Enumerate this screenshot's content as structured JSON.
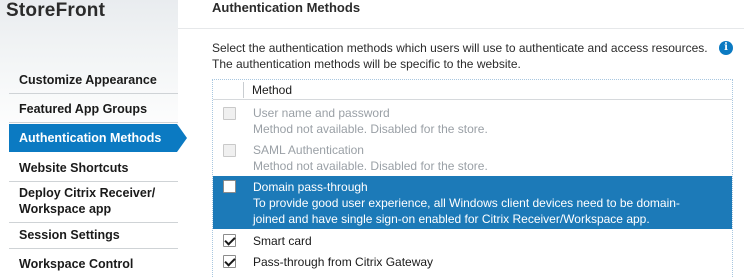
{
  "app": {
    "title": "StoreFront"
  },
  "sidebar": {
    "items": [
      {
        "label": "Customize Appearance"
      },
      {
        "label": "Featured App Groups"
      },
      {
        "label": "Authentication Methods",
        "active": true
      },
      {
        "label": "Website Shortcuts"
      },
      {
        "label_line1": "Deploy Citrix Receiver/",
        "label_line2": "Workspace app"
      },
      {
        "label": "Session Settings"
      },
      {
        "label": "Workspace Control"
      }
    ]
  },
  "panel": {
    "title": "Authentication Methods",
    "description_line1": "Select the authentication methods which users will use to authenticate and access resources.",
    "description_line2": "The authentication methods will be specific to the website.",
    "info_icon": "i"
  },
  "table": {
    "header": "Method",
    "rows": [
      {
        "title": "User name and password",
        "subtitle": "Method not available. Disabled for the store.",
        "checked": false,
        "disabled": true
      },
      {
        "title": "SAML Authentication",
        "subtitle": "Method not available. Disabled for the store.",
        "checked": false,
        "disabled": true
      },
      {
        "title": "Domain pass-through",
        "subtitle_line1": "To provide good user experience, all Windows client devices need to be domain-",
        "subtitle_line2": "joined and have single sign-on enabled for Citrix Receiver/Workspace app.",
        "checked": false,
        "selected": true
      },
      {
        "title": "Smart card",
        "checked": true
      },
      {
        "title": "Pass-through from Citrix Gateway",
        "checked": true
      }
    ]
  },
  "colors": {
    "accent": "#0b7ac2",
    "selected_row": "#1c7ab8",
    "disabled_text": "#9aa0a6"
  }
}
